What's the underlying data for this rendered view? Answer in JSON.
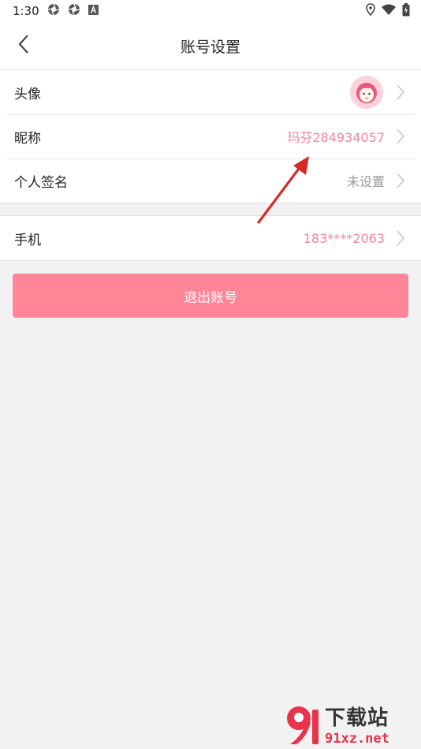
{
  "status_bar": {
    "time": "1:30",
    "left_icons": [
      "aperture-icon",
      "aperture-icon",
      "a-box-icon"
    ],
    "right_icons": [
      "location-icon",
      "wifi-icon",
      "battery-icon"
    ]
  },
  "header": {
    "title": "账号设置",
    "back_icon": "chevron-left-icon"
  },
  "profile_group": [
    {
      "label": "头像",
      "value": "",
      "type": "avatar"
    },
    {
      "label": "昵称",
      "value": "玛芬284934057",
      "value_color": "#f4869b"
    },
    {
      "label": "个人签名",
      "value": "未设置",
      "value_color": "#999999"
    }
  ],
  "contact_group": [
    {
      "label": "手机",
      "value": "183****2063",
      "value_color": "#f4869b"
    }
  ],
  "logout_button": {
    "label": "退出账号",
    "color": "#ff8597"
  },
  "watermark": {
    "brand": "下载站",
    "url": "91xz.net",
    "logo": "91"
  },
  "colors": {
    "accent": "#ff8597",
    "value_pink": "#f4869b",
    "background": "#f3f2f3",
    "annotation_arrow": "#d62a2a"
  }
}
